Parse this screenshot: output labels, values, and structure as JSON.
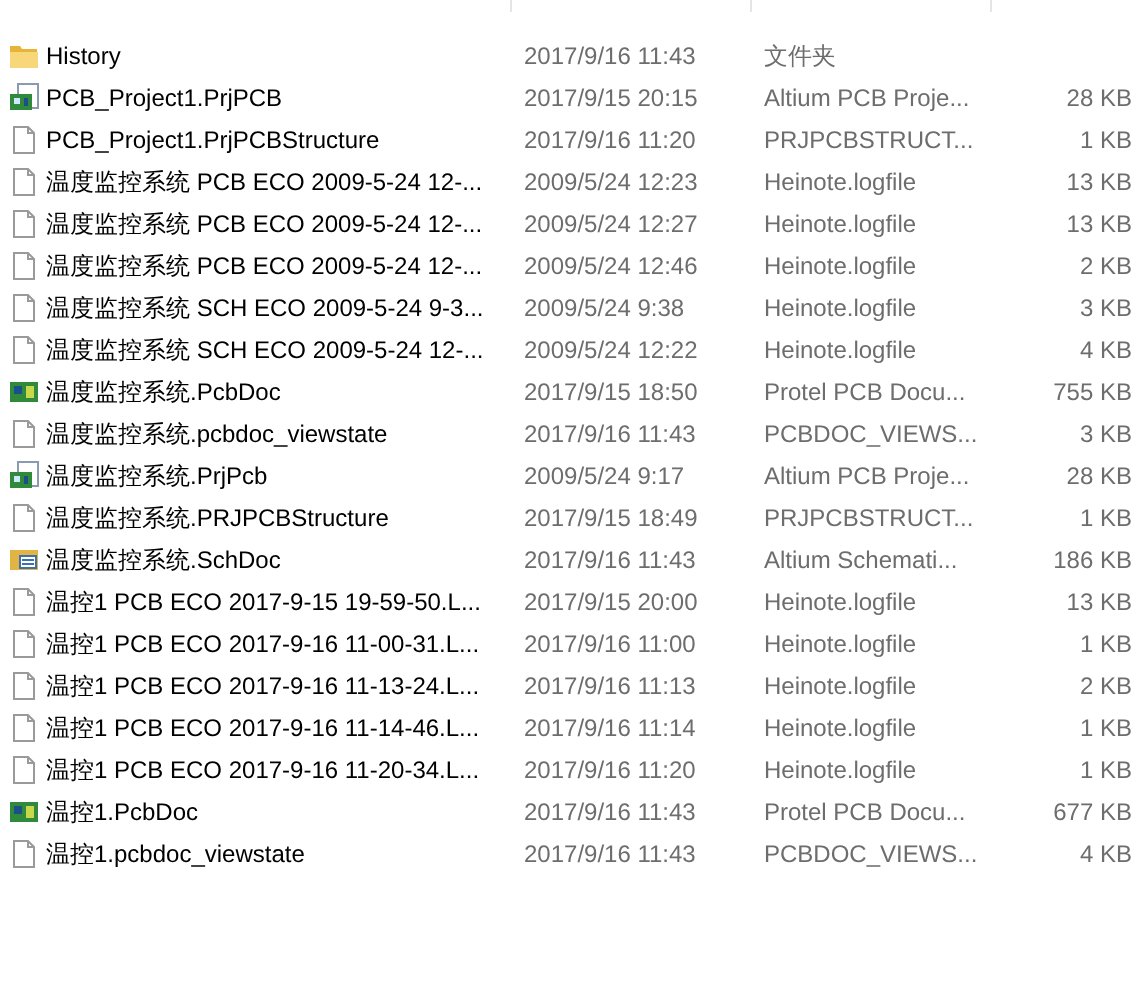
{
  "files": [
    {
      "kind": "folder",
      "name": "History",
      "modified": "2017/9/16 11:43",
      "type": "文件夹"
    },
    {
      "kind": "project",
      "name": "PCB_Project1.PrjPCB",
      "modified": "2017/9/15 20:15",
      "type": "Altium PCB Proje...",
      "size": "28 KB"
    },
    {
      "kind": "file",
      "name": "PCB_Project1.PrjPCBStructure",
      "modified": "2017/9/16 11:20",
      "type": "PRJPCBSTRUCT...",
      "size": "1 KB"
    },
    {
      "kind": "file",
      "name": "温度监控系统 PCB ECO 2009-5-24 12-...",
      "modified": "2009/5/24 12:23",
      "type": "Heinote.logfile",
      "size": "13 KB"
    },
    {
      "kind": "file",
      "name": "温度监控系统 PCB ECO 2009-5-24 12-...",
      "modified": "2009/5/24 12:27",
      "type": "Heinote.logfile",
      "size": "13 KB"
    },
    {
      "kind": "file",
      "name": "温度监控系统 PCB ECO 2009-5-24 12-...",
      "modified": "2009/5/24 12:46",
      "type": "Heinote.logfile",
      "size": "2 KB"
    },
    {
      "kind": "file",
      "name": "温度监控系统 SCH ECO 2009-5-24 9-3...",
      "modified": "2009/5/24 9:38",
      "type": "Heinote.logfile",
      "size": "3 KB"
    },
    {
      "kind": "file",
      "name": "温度监控系统 SCH ECO 2009-5-24 12-...",
      "modified": "2009/5/24 12:22",
      "type": "Heinote.logfile",
      "size": "4 KB"
    },
    {
      "kind": "pcb",
      "name": "温度监控系统.PcbDoc",
      "modified": "2017/9/15 18:50",
      "type": "Protel PCB Docu...",
      "size": "755 KB"
    },
    {
      "kind": "file",
      "name": "温度监控系统.pcbdoc_viewstate",
      "modified": "2017/9/16 11:43",
      "type": "PCBDOC_VIEWS...",
      "size": "3 KB"
    },
    {
      "kind": "project",
      "name": "温度监控系统.PrjPcb",
      "modified": "2009/5/24 9:17",
      "type": "Altium PCB Proje...",
      "size": "28 KB"
    },
    {
      "kind": "file",
      "name": "温度监控系统.PRJPCBStructure",
      "modified": "2017/9/15 18:49",
      "type": "PRJPCBSTRUCT...",
      "size": "1 KB"
    },
    {
      "kind": "schematic",
      "name": "温度监控系统.SchDoc",
      "modified": "2017/9/16 11:43",
      "type": "Altium Schemati...",
      "size": "186 KB"
    },
    {
      "kind": "file",
      "name": "温控1 PCB ECO 2017-9-15 19-59-50.L...",
      "modified": "2017/9/15 20:00",
      "type": "Heinote.logfile",
      "size": "13 KB"
    },
    {
      "kind": "file",
      "name": "温控1 PCB ECO 2017-9-16 11-00-31.L...",
      "modified": "2017/9/16 11:00",
      "type": "Heinote.logfile",
      "size": "1 KB"
    },
    {
      "kind": "file",
      "name": "温控1 PCB ECO 2017-9-16 11-13-24.L...",
      "modified": "2017/9/16 11:13",
      "type": "Heinote.logfile",
      "size": "2 KB"
    },
    {
      "kind": "file",
      "name": "温控1 PCB ECO 2017-9-16 11-14-46.L...",
      "modified": "2017/9/16 11:14",
      "type": "Heinote.logfile",
      "size": "1 KB"
    },
    {
      "kind": "file",
      "name": "温控1 PCB ECO 2017-9-16 11-20-34.L...",
      "modified": "2017/9/16 11:20",
      "type": "Heinote.logfile",
      "size": "1 KB"
    },
    {
      "kind": "pcb",
      "name": "温控1.PcbDoc",
      "modified": "2017/9/16 11:43",
      "type": "Protel PCB Docu...",
      "size": "677 KB"
    },
    {
      "kind": "file",
      "name": "温控1.pcbdoc_viewstate",
      "modified": "2017/9/16 11:43",
      "type": "PCBDOC_VIEWS...",
      "size": "4 KB"
    }
  ]
}
